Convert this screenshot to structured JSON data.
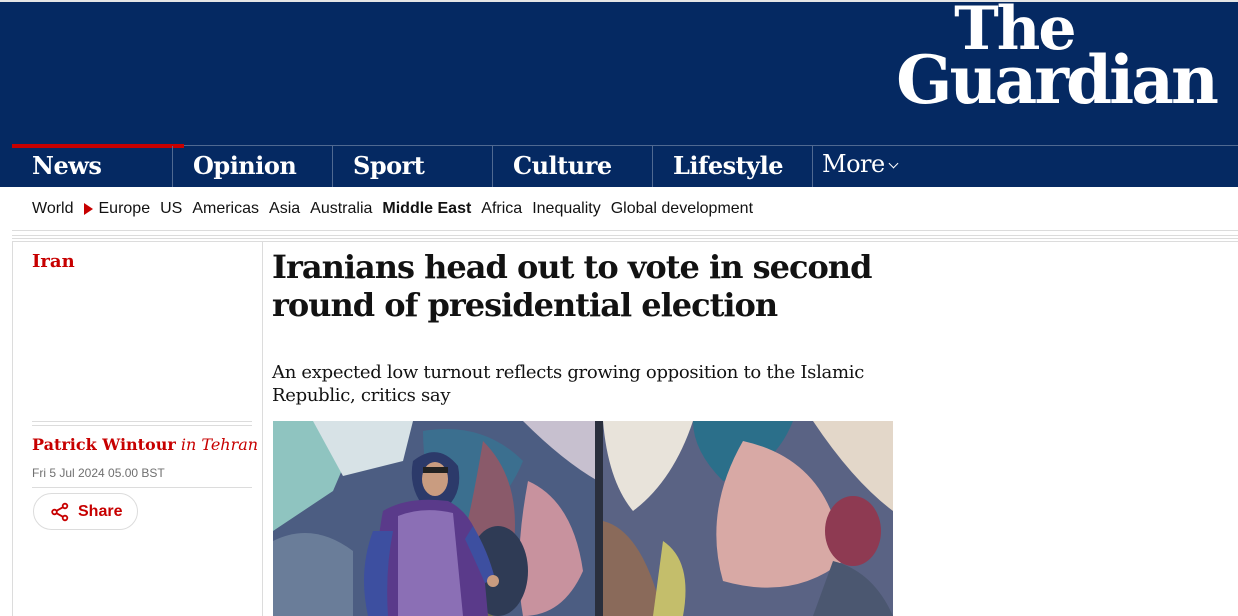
{
  "masthead": {
    "logo_line1": "The",
    "logo_line2": "Guardian"
  },
  "pillars": [
    {
      "label": "News",
      "active": true
    },
    {
      "label": "Opinion"
    },
    {
      "label": "Sport"
    },
    {
      "label": "Culture"
    },
    {
      "label": "Lifestyle"
    },
    {
      "label": "More"
    }
  ],
  "subnav": {
    "items": [
      "World",
      "Europe",
      "US",
      "Americas",
      "Asia",
      "Australia",
      "Middle East",
      "Africa",
      "Inequality",
      "Global development"
    ],
    "current": "Middle East"
  },
  "article": {
    "section": "Iran",
    "headline": "Iranians head out to vote in second round of presidential election",
    "standfirst": "An expected low turnout reflects growing opposition to the Islamic Republic, critics say",
    "author": "Patrick Wintour",
    "location": "in Tehran",
    "date": "Fri 5 Jul 2024 05.00 BST",
    "share_label": "Share"
  },
  "colors": {
    "brand_blue": "#052962",
    "news_red": "#c70000",
    "text": "#121212",
    "muted": "#707070",
    "rule": "#dcdcdc"
  }
}
